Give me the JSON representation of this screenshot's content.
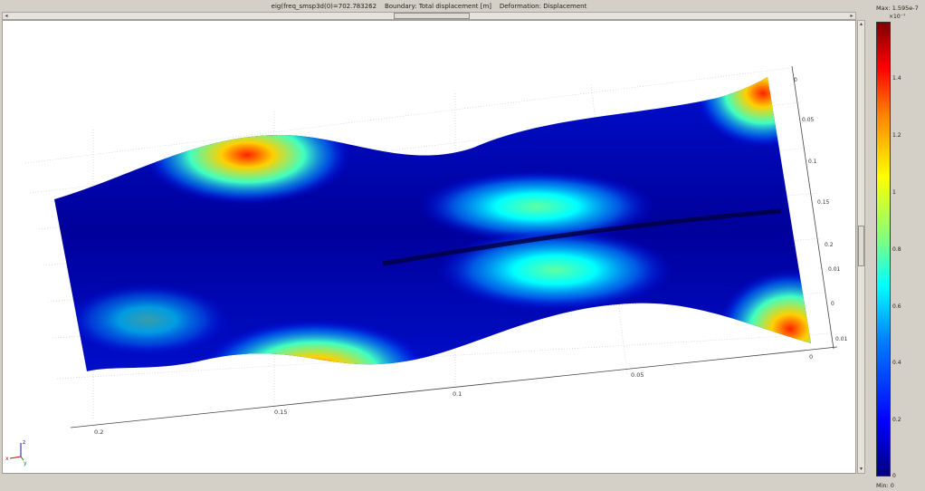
{
  "plot": {
    "title": "eig(freq_smsp3d(0)=702.783262    Boundary: Total displacement [m]    Deformation: Displacement"
  },
  "axes": {
    "front_ticks": [
      "0.2",
      "0.15",
      "0.1",
      "0.05",
      "0"
    ],
    "side_ticks": [
      "0",
      "0.05",
      "0.1",
      "0.15",
      "0.2",
      "0.01",
      "0",
      "0.01"
    ],
    "triad": {
      "z": "z",
      "x": "x",
      "y": "y"
    }
  },
  "colorbar": {
    "max_label": "Max: 1.595e-7",
    "exponent": "×10⁻⁷",
    "min_label": "Min: 0",
    "ticks": [
      "1.4",
      "1.2",
      "1",
      "0.8",
      "0.6",
      "0.4",
      "0.2",
      "0"
    ],
    "colormap": [
      "#00007f",
      "#0000ff",
      "#0080ff",
      "#00ffff",
      "#80ff80",
      "#ffff00",
      "#ff8000",
      "#ff0000",
      "#7f0000"
    ]
  },
  "icons": {
    "left_arrow": "◂",
    "right_arrow": "▸",
    "up_arrow": "▴",
    "down_arrow": "▾"
  }
}
